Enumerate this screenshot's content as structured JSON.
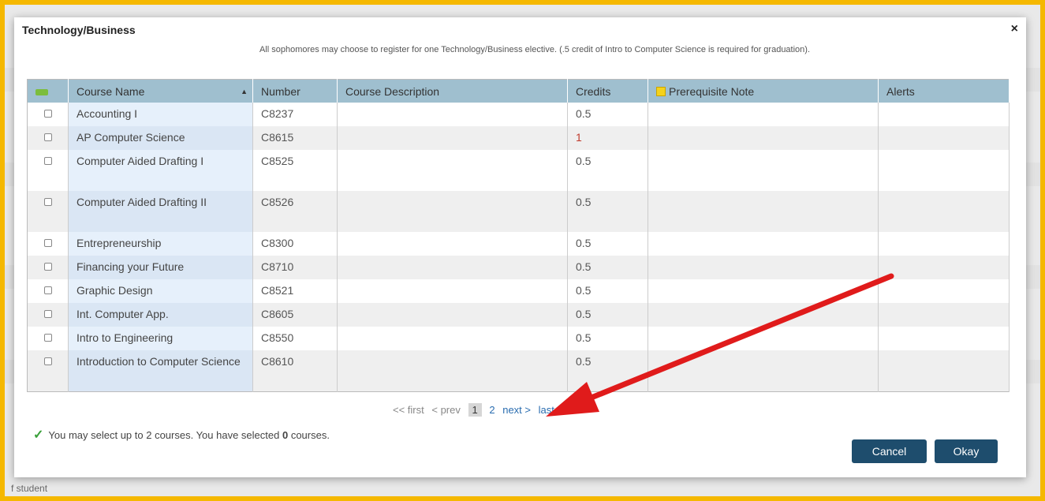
{
  "dialog": {
    "title": "Technology/Business",
    "close_label": "×",
    "intro": "All sophomores may choose to register for one Technology/Business elective. (.5 credit of Intro to Computer Science is required for graduation)."
  },
  "table": {
    "headers": [
      "",
      "Course Name",
      "Number",
      "Course Description",
      "Credits",
      "Prerequisite Note",
      "Alerts"
    ],
    "rows": [
      {
        "name": "Accounting I",
        "number": "C8237",
        "description": "",
        "credits": "0.5",
        "note": "",
        "alerts": ""
      },
      {
        "name": "AP Computer Science",
        "number": "C8615",
        "description": "",
        "credits": "1",
        "note": "",
        "alerts": ""
      },
      {
        "name": "Computer Aided Drafting I",
        "number": "C8525",
        "description": "",
        "credits": "0.5",
        "note": "",
        "alerts": ""
      },
      {
        "name": "Computer Aided Drafting II",
        "number": "C8526",
        "description": "",
        "credits": "0.5",
        "note": "",
        "alerts": ""
      },
      {
        "name": "Entrepreneurship",
        "number": "C8300",
        "description": "",
        "credits": "0.5",
        "note": "",
        "alerts": ""
      },
      {
        "name": "Financing your Future",
        "number": "C8710",
        "description": "",
        "credits": "0.5",
        "note": "",
        "alerts": ""
      },
      {
        "name": "Graphic Design",
        "number": "C8521",
        "description": "",
        "credits": "0.5",
        "note": "",
        "alerts": ""
      },
      {
        "name": "Int. Computer App.",
        "number": "C8605",
        "description": "",
        "credits": "0.5",
        "note": "",
        "alerts": ""
      },
      {
        "name": "Intro to Engineering",
        "number": "C8550",
        "description": "",
        "credits": "0.5",
        "note": "",
        "alerts": ""
      },
      {
        "name": "Introduction to Computer Science",
        "number": "C8610",
        "description": "",
        "credits": "0.5",
        "note": "",
        "alerts": ""
      }
    ]
  },
  "pager": {
    "first": "<< first",
    "prev": "< prev",
    "current": "1",
    "page2": "2",
    "next": "next >",
    "last": "last >>"
  },
  "selection": {
    "prefix": "You may select up to 2 courses. You have selected ",
    "count": "0",
    "suffix": " courses."
  },
  "buttons": {
    "cancel": "Cancel",
    "okay": "Okay"
  },
  "background": {
    "footer": "f student"
  },
  "colors": {
    "frame": "#f5b800",
    "header": "#9fbfcf",
    "button": "#1e4d6d",
    "arrow": "#e01b1b"
  }
}
